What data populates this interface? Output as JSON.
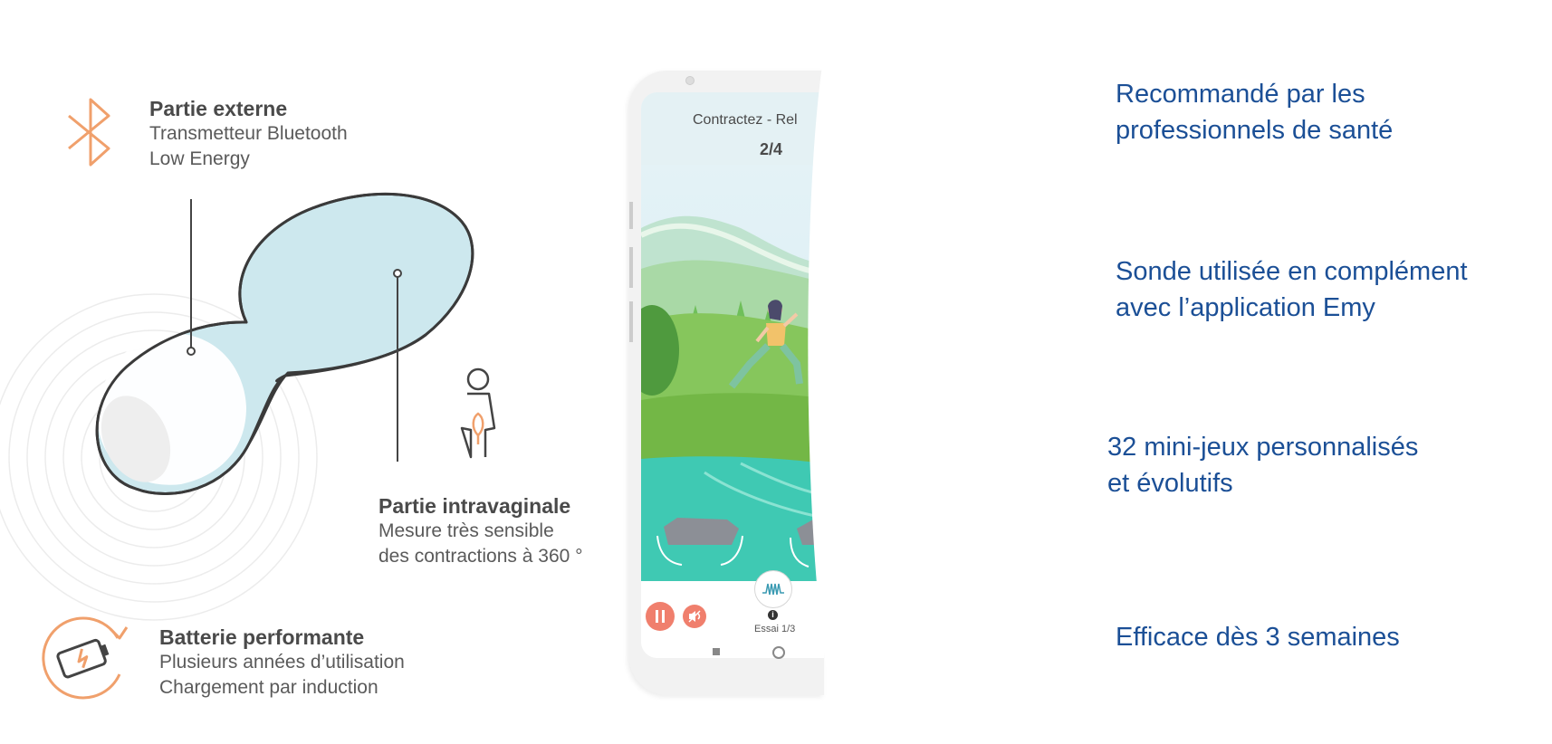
{
  "features": {
    "external": {
      "title": "Partie externe",
      "line1": "Transmetteur Bluetooth",
      "line2": "Low Energy",
      "icon": "bluetooth-icon"
    },
    "intravaginal": {
      "title": "Partie intravaginale",
      "line1": "Mesure très sensible",
      "line2": "des contractions à 360 °",
      "icon": "woman-pelvis-icon"
    },
    "battery": {
      "title": "Batterie performante",
      "line1": "Plusieurs années d’utilisation",
      "line2": "Chargement par induction",
      "icon": "battery-charging-icon"
    }
  },
  "phone": {
    "instruction": "Contractez - Rel",
    "progress": "2/4",
    "attempt": "Essai 1/3",
    "info_glyph": "i",
    "game_name": "runner-game-illustration"
  },
  "benefits": [
    {
      "line1": "Recommandé  par les",
      "line2": "professionnels  de santé"
    },
    {
      "line1": "Sonde  utilisée  en complément",
      "line2": "avec l’application  Emy"
    },
    {
      "line1": "32 mini-jeux personnalisés",
      "line2": "et évolutifs"
    },
    {
      "line1": "Efficace dès 3 semaines",
      "line2": ""
    }
  ],
  "colors": {
    "accent_orange": "#f0a06c",
    "benefit_blue": "#1b4f96",
    "probe_blue": "#cde8ee",
    "probe_outline": "#3a3a3a"
  }
}
